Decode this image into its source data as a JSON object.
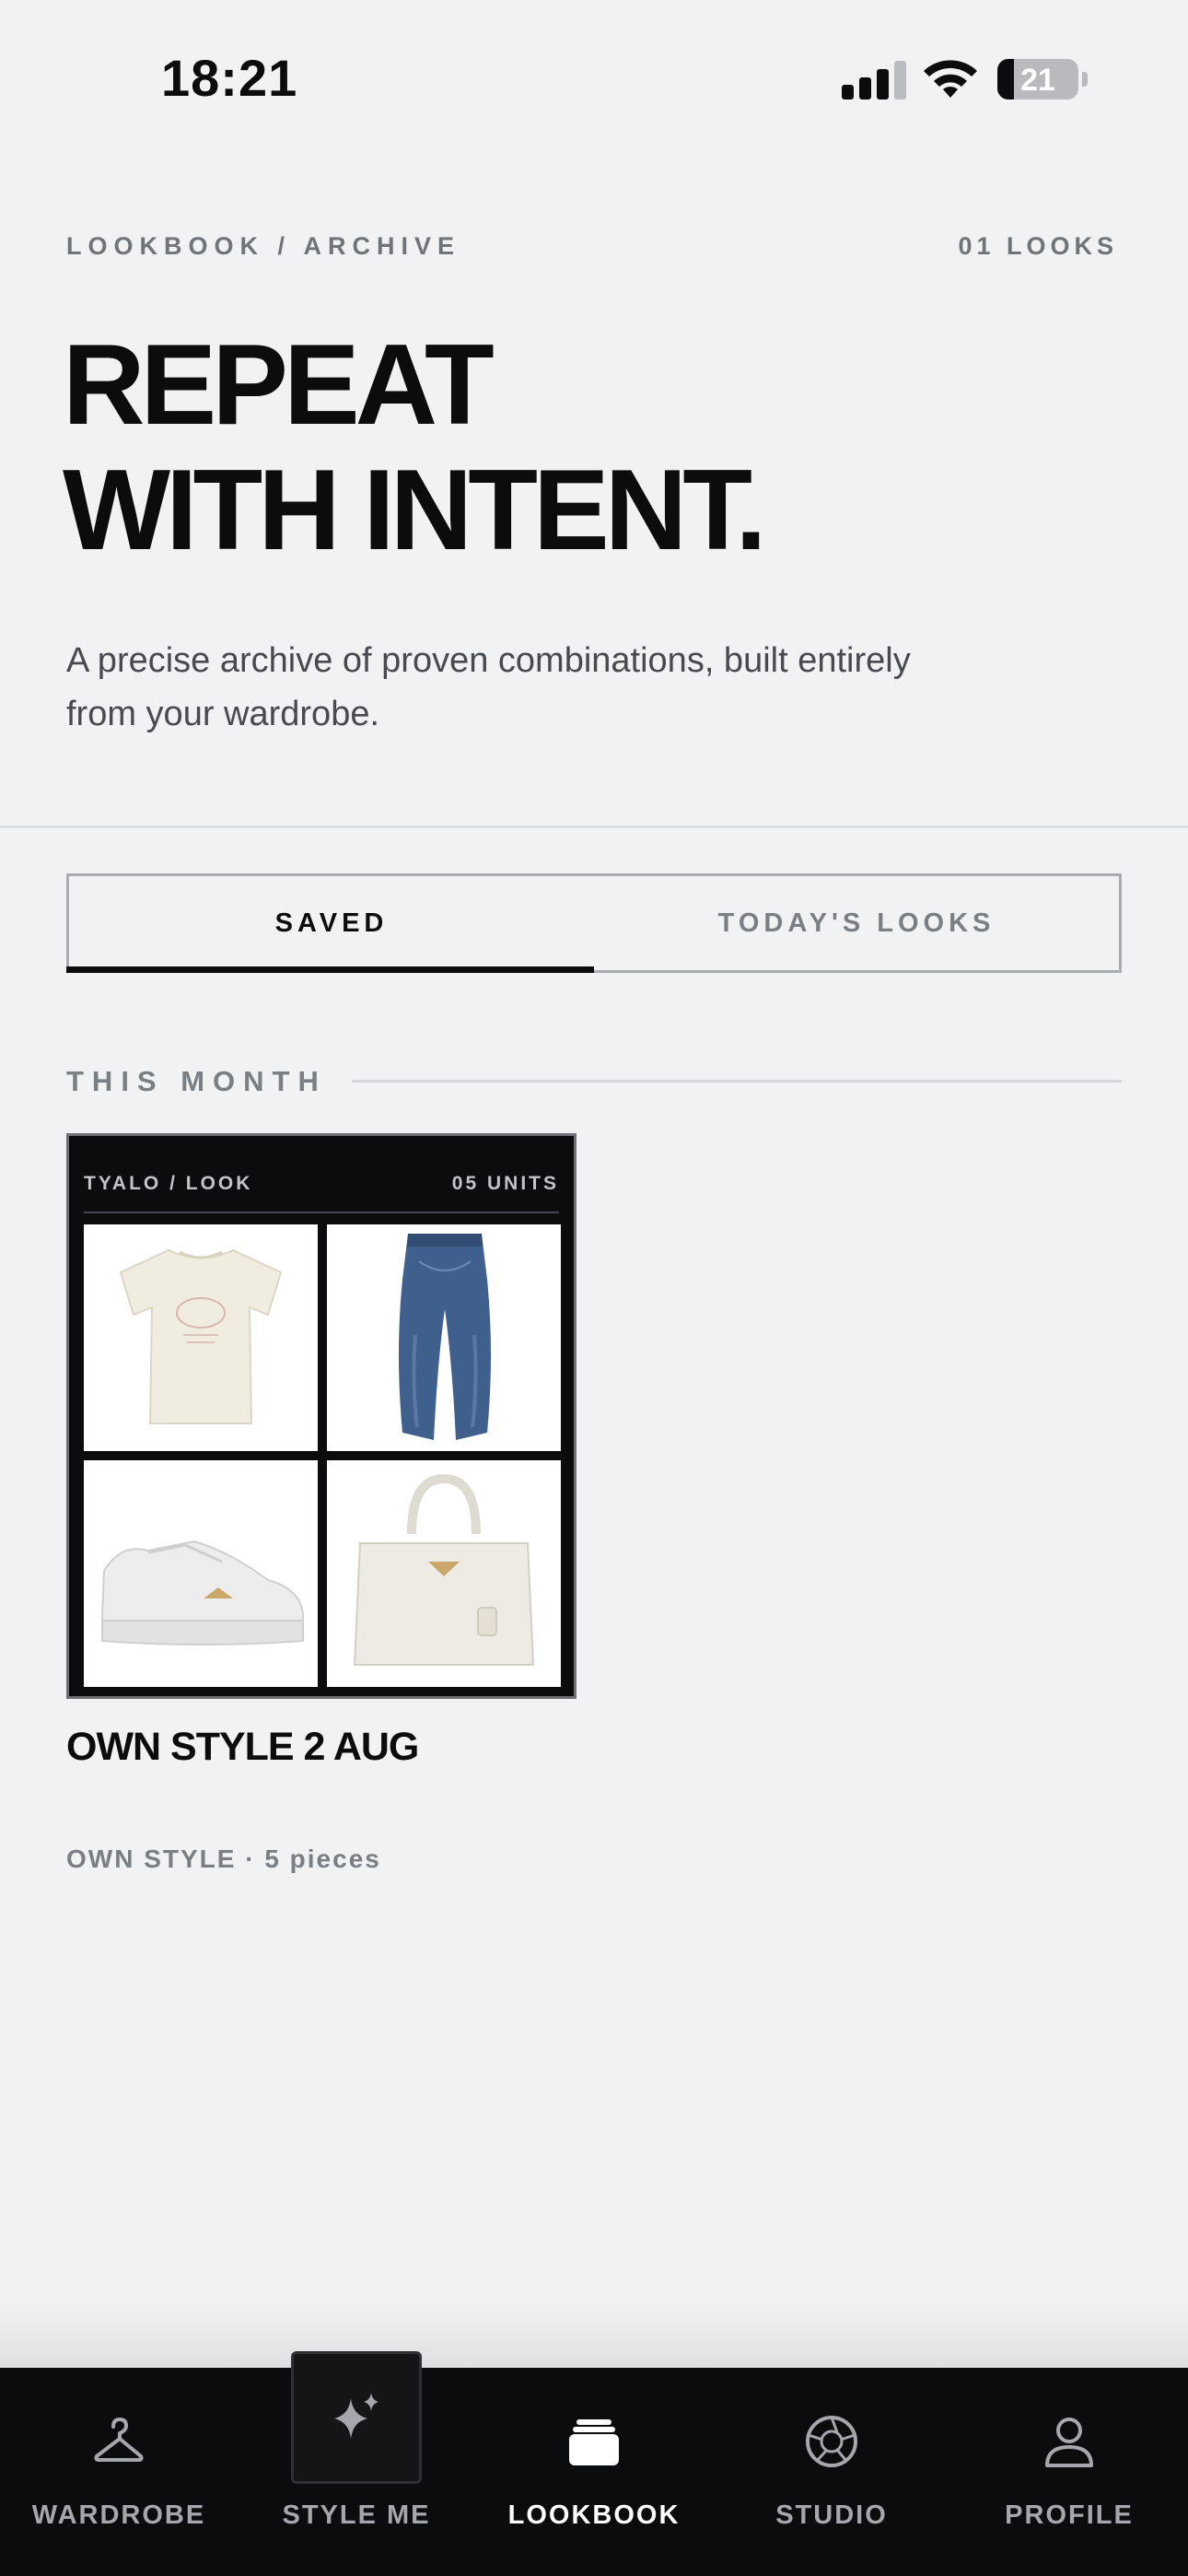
{
  "status_bar": {
    "time": "18:21",
    "battery_percent": "21",
    "battery_level": 0.21,
    "signal_icon": "cellular-signal-icon",
    "wifi_icon": "wifi-icon"
  },
  "header": {
    "breadcrumb": "LOOKBOOK / ARCHIVE",
    "looks_count": "01 LOOKS",
    "headline_line1": "REPEAT",
    "headline_line2": "WITH INTENT.",
    "subtitle": "A precise archive of proven combinations, built entirely from your wardrobe."
  },
  "tabs": [
    {
      "label": "SAVED",
      "active": true
    },
    {
      "label": "TODAY'S LOOKS",
      "active": false
    }
  ],
  "section": {
    "label": "THIS MONTH"
  },
  "look": {
    "brand": "TYALO / LOOK",
    "units": "05 UNITS",
    "items": [
      "t-shirt",
      "jeans",
      "sneakers",
      "handbag"
    ],
    "title": "OWN STYLE 2 AUG",
    "meta": "OWN STYLE · 5 pieces"
  },
  "bottom_nav": [
    {
      "label": "WARDROBE",
      "icon": "hanger-icon",
      "active": false
    },
    {
      "label": "STYLE ME",
      "icon": "sparkles-icon",
      "active": false
    },
    {
      "label": "LOOKBOOK",
      "icon": "stack-icon",
      "active": true
    },
    {
      "label": "STUDIO",
      "icon": "aperture-icon",
      "active": false
    },
    {
      "label": "PROFILE",
      "icon": "user-icon",
      "active": false
    }
  ],
  "colors": {
    "background": "#f0f2f4",
    "ink": "#0b0c0d",
    "muted": "#7a7f84",
    "nav_background": "#0b0c0d",
    "denim": "#3b5a86"
  }
}
